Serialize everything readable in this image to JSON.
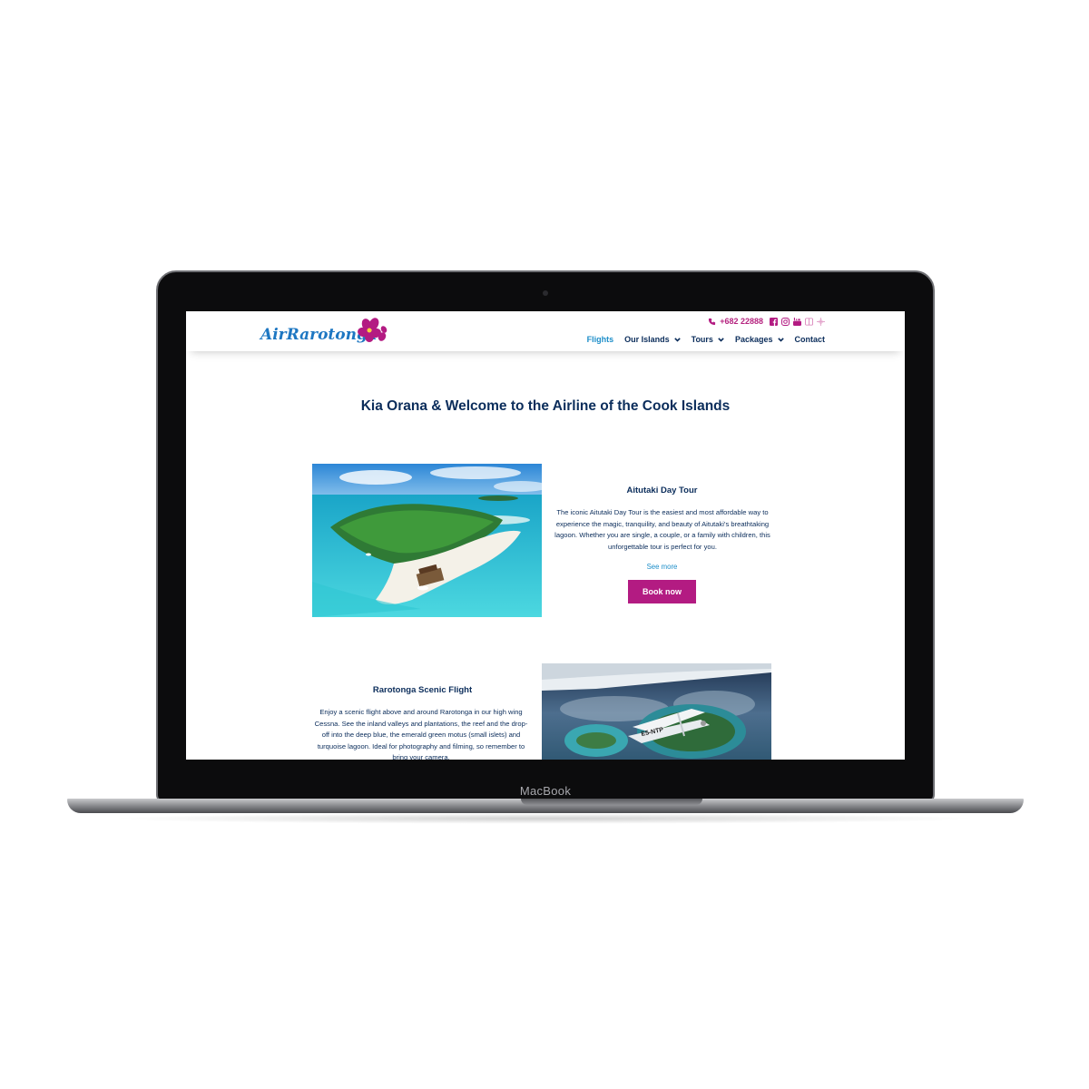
{
  "device": {
    "label": "MacBook"
  },
  "header": {
    "logo_text": "AirRarotonga",
    "phone": "+682 22888",
    "social_icons": [
      "phone-icon",
      "facebook-icon",
      "instagram-icon",
      "youtube-icon",
      "tripadvisor-icon",
      "app-icon"
    ],
    "nav": [
      {
        "label": "Flights",
        "active": true
      },
      {
        "label": "Our Islands",
        "dropdown": true
      },
      {
        "label": "Tours",
        "dropdown": true
      },
      {
        "label": "Packages",
        "dropdown": true
      },
      {
        "label": "Contact"
      }
    ]
  },
  "main": {
    "heading": "Kia Orana & Welcome to the Airline of the Cook Islands",
    "tour1": {
      "title": "Aitutaki Day Tour",
      "text": "The iconic Aitutaki Day Tour is the easiest and most affordable way to experience the magic, tranquility, and beauty of Aitutaki's breathtaking lagoon. Whether you are single, a couple, or a family with children, this unforgettable tour is perfect for you.",
      "see_more": "See more",
      "button": "Book now"
    },
    "tour2": {
      "title": "Rarotonga Scenic Flight",
      "text": "Enjoy a scenic flight above and around Rarotonga in our high wing Cessna. See the inland valleys and plantations, the reef and the drop-off into the deep blue, the emerald green motus (small islets) and turquoise lagoon. Ideal for photography and filming, so remember to bring your camera.",
      "plane_reg": "E5-NTP"
    }
  },
  "colors": {
    "navy": "#0b2d5b",
    "magenta": "#b31b82",
    "link_blue": "#1d8ec9"
  }
}
